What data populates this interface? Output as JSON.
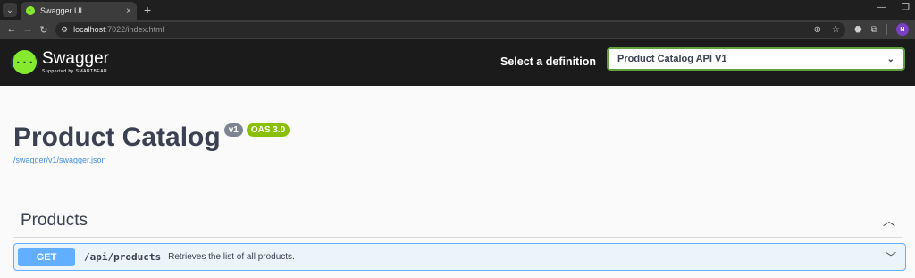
{
  "browser": {
    "tab_title": "Swagger UI",
    "tab_close": "×",
    "new_tab": "+",
    "url_host": "localhost",
    "url_rest": ":7022/index.html",
    "avatar_initial": "N"
  },
  "topbar": {
    "logo_mark": "{···}",
    "logo_name": "Swagger",
    "logo_sub": "Supported by SMARTBEAR",
    "definition_label": "Select a definition",
    "definition_value": "Product Catalog API V1"
  },
  "info": {
    "title": "Product Catalog",
    "version_badge": "v1",
    "oas_badge": "OAS 3.0",
    "spec_link": "/swagger/v1/swagger.json"
  },
  "tags": [
    {
      "name": "Products",
      "operations": [
        {
          "method": "GET",
          "path": "/api/products",
          "summary": "Retrieves the list of all products."
        }
      ]
    }
  ],
  "colors": {
    "accent_green": "#85ea2d",
    "get_blue": "#61affe",
    "oas_green": "#89bf04"
  }
}
